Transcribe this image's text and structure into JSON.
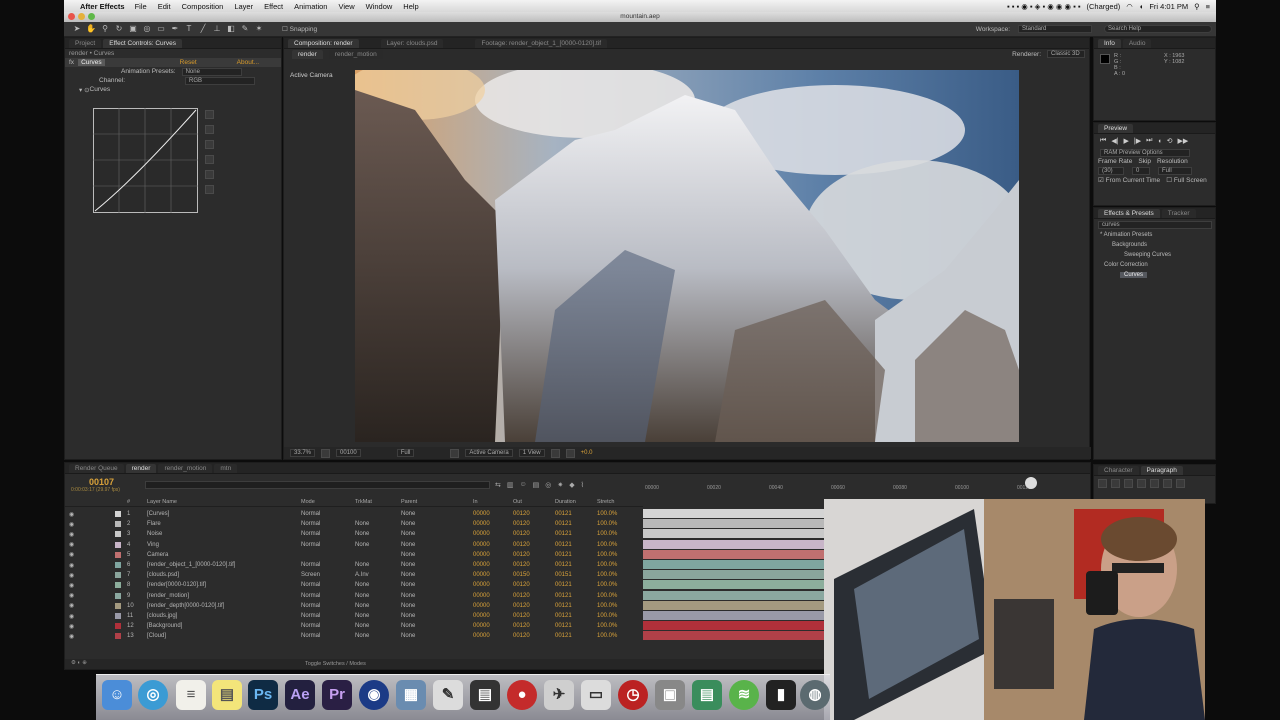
{
  "menubar": {
    "app_name": "After Effects",
    "items": [
      "File",
      "Edit",
      "Composition",
      "Layer",
      "Effect",
      "Animation",
      "View",
      "Window",
      "Help"
    ],
    "battery": "(Charged)",
    "clock": "Fri 4:01 PM",
    "colors": {
      "bar": "#e5e5e5"
    }
  },
  "titlebar": {
    "title": "mountain.aep"
  },
  "toolbar": {
    "snapping_label": "Snapping",
    "workspace_label": "Workspace:",
    "workspace_value": "Standard",
    "search_placeholder": "Search Help"
  },
  "effect_controls": {
    "tabs": [
      "Project",
      "Effect Controls: Curves"
    ],
    "breadcrumb": "render • Curves",
    "effect_name": "Curves",
    "reset_label": "Reset",
    "about_label": "About...",
    "presets_label": "Animation Presets:",
    "presets_value": "None",
    "channel_label": "Channel:",
    "channel_value": "RGB",
    "curves_label": "Curves"
  },
  "composition": {
    "tabs": [
      "Composition: render",
      "Layer: clouds.psd",
      "Footage: render_object_1_[0000-0120].tif"
    ],
    "subtabs": [
      "render",
      "render_motion"
    ],
    "renderer_label": "Renderer:",
    "renderer_value": "Classic 3D",
    "camera_label": "Active Camera",
    "footer": {
      "zoom": "33.7%",
      "timecode": "00100",
      "resolution": "Full",
      "camera": "Active Camera",
      "views": "1 View",
      "exposure": "+0.0"
    }
  },
  "info_panel": {
    "tabs": [
      "Info",
      "Audio"
    ],
    "r_label": "R :",
    "g_label": "G :",
    "b_label": "B :",
    "a_label": "A : 0",
    "x_value": "X : 1963",
    "y_value": "Y : 1082"
  },
  "preview_panel": {
    "tab": "Preview",
    "ram_options": "RAM Preview Options",
    "frame_rate_label": "Frame Rate",
    "skip_label": "Skip",
    "resolution_label": "Resolution",
    "frame_rate_value": "(30)",
    "skip_value": "0",
    "resolution_value": "Full",
    "from_current_label": "From Current Time",
    "full_screen_label": "Full Screen"
  },
  "effects_presets": {
    "tabs": [
      "Effects & Presets",
      "Tracker"
    ],
    "search_value": "curves",
    "tree": [
      "* Animation Presets",
      "Backgrounds",
      "Sweeping Curves",
      "Color Correction",
      "Curves"
    ]
  },
  "bottom_right_panel": {
    "tabs": [
      "Character",
      "Paragraph"
    ]
  },
  "timeline": {
    "tabs": [
      "Render Queue",
      "render",
      "render_motion",
      "mtn"
    ],
    "timecode": "00107",
    "timecode_sub": "0:00:03:17 (29.97 fps)",
    "search_placeholder": "",
    "headers": {
      "num": "#",
      "name": "Layer Name",
      "mode": "Mode",
      "trkmat": "TrkMat",
      "parent": "Parent",
      "in": "In",
      "out": "Out",
      "duration": "Duration",
      "stretch": "Stretch"
    },
    "ruler": [
      "00000",
      "00020",
      "00040",
      "00060",
      "00080",
      "00100",
      "00120"
    ],
    "toggle_label": "Toggle Switches / Modes",
    "layers": [
      {
        "num": "1",
        "name": "[Curves]",
        "mode": "Normal",
        "trk": "",
        "parent": "None",
        "in": "00000",
        "out": "00120",
        "dur": "00121",
        "stretch": "100.0%",
        "color": "#d4d4d4"
      },
      {
        "num": "2",
        "name": "Flare",
        "mode": "Normal",
        "trk": "None",
        "parent": "None",
        "in": "00000",
        "out": "00120",
        "dur": "00121",
        "stretch": "100.0%",
        "color": "#b9b9b9"
      },
      {
        "num": "3",
        "name": "Noise",
        "mode": "Normal",
        "trk": "None",
        "parent": "None",
        "in": "00000",
        "out": "00120",
        "dur": "00121",
        "stretch": "100.0%",
        "color": "#c9c9c9"
      },
      {
        "num": "4",
        "name": "Ving",
        "mode": "Normal",
        "trk": "None",
        "parent": "None",
        "in": "00000",
        "out": "00120",
        "dur": "00121",
        "stretch": "100.0%",
        "color": "#c8b5c8"
      },
      {
        "num": "5",
        "name": "Camera",
        "mode": "",
        "trk": "",
        "parent": "None",
        "in": "00000",
        "out": "00120",
        "dur": "00121",
        "stretch": "100.0%",
        "color": "#c07070"
      },
      {
        "num": "6",
        "name": "[render_object_1_[0000-0120].tif]",
        "mode": "Normal",
        "trk": "None",
        "parent": "None",
        "in": "00000",
        "out": "00120",
        "dur": "00121",
        "stretch": "100.0%",
        "color": "#7fa6a0"
      },
      {
        "num": "7",
        "name": "[clouds.psd]",
        "mode": "Screen",
        "trk": "A.Inv",
        "parent": "None",
        "in": "00000",
        "out": "00150",
        "dur": "00151",
        "stretch": "100.0%",
        "color": "#8aa59c"
      },
      {
        "num": "8",
        "name": "[render[0000-0120].tif]",
        "mode": "Normal",
        "trk": "None",
        "parent": "None",
        "in": "00000",
        "out": "00120",
        "dur": "00121",
        "stretch": "100.0%",
        "color": "#8cae9c"
      },
      {
        "num": "9",
        "name": "[render_motion]",
        "mode": "Normal",
        "trk": "None",
        "parent": "None",
        "in": "00000",
        "out": "00120",
        "dur": "00121",
        "stretch": "100.0%",
        "color": "#8ba8a0"
      },
      {
        "num": "10",
        "name": "[render_depth[0000-0120].tif]",
        "mode": "Normal",
        "trk": "None",
        "parent": "None",
        "in": "00000",
        "out": "00120",
        "dur": "00121",
        "stretch": "100.0%",
        "color": "#a49a80"
      },
      {
        "num": "11",
        "name": "[clouds.jpg]",
        "mode": "Normal",
        "trk": "None",
        "parent": "None",
        "in": "00000",
        "out": "00120",
        "dur": "00121",
        "stretch": "100.0%",
        "color": "#9a9aa8"
      },
      {
        "num": "12",
        "name": "[Background]",
        "mode": "Normal",
        "trk": "None",
        "parent": "None",
        "in": "00000",
        "out": "00120",
        "dur": "00121",
        "stretch": "100.0%",
        "color": "#b0303a"
      },
      {
        "num": "13",
        "name": "[Cloud]",
        "mode": "Normal",
        "trk": "None",
        "parent": "None",
        "in": "00000",
        "out": "00120",
        "dur": "00121",
        "stretch": "100.0%",
        "color": "#b04048"
      }
    ]
  },
  "dock": {
    "icons": [
      "finder-icon",
      "safari-icon",
      "text-edit-icon",
      "stickies-icon",
      "Ps",
      "Ae",
      "Pr",
      "cinema4d-icon",
      "preview-icon",
      "script-icon",
      "clapper-icon",
      "apple-red-icon",
      "mail-icon",
      "screen-icon",
      "clock-icon",
      "photo-icon",
      "monitor-icon",
      "spotify-icon",
      "terminal-icon",
      "sphere-icon"
    ],
    "ps_label": "Ps",
    "ae_label": "Ae",
    "pr_label": "Pr"
  }
}
